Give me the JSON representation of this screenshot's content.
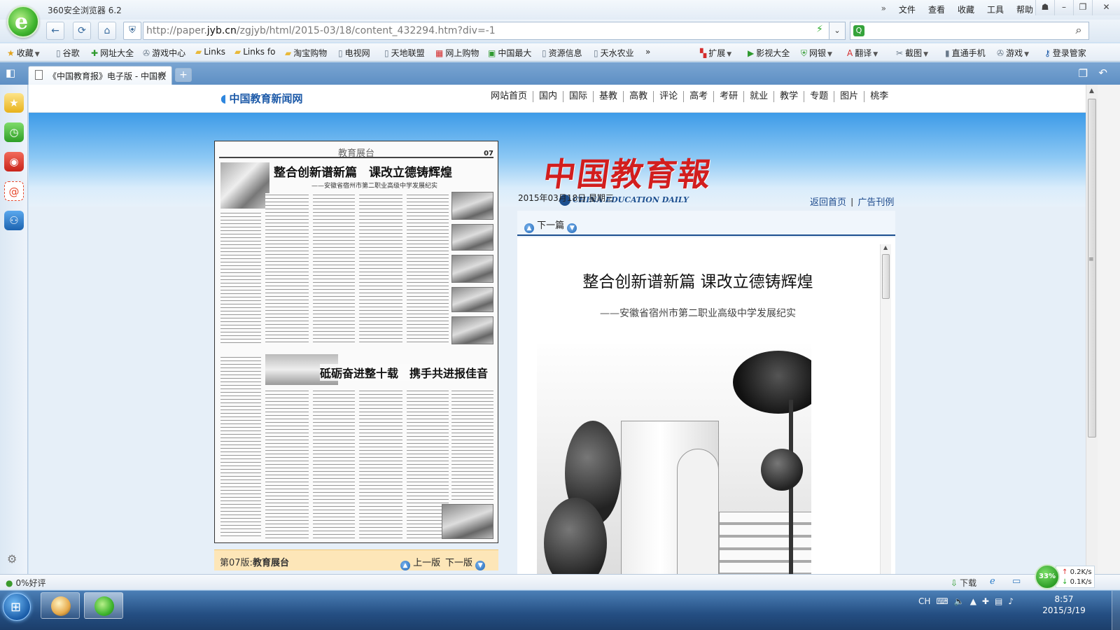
{
  "window": {
    "app_title": "360安全浏览器 6.2",
    "menu": [
      "文件",
      "查看",
      "收藏",
      "工具",
      "帮助"
    ],
    "menu_chevron": "»"
  },
  "navbar": {
    "url_prefix": "http://paper.",
    "url_domain": "jyb.cn",
    "url_suffix": "/zgjyb/html/2015-03/18/content_432294.htm?div=-1",
    "search_placeholder": ""
  },
  "bookmarks": {
    "left": [
      {
        "label": "收藏",
        "icon": "star-icon"
      },
      {
        "label": "谷歌",
        "icon": "page-icon"
      },
      {
        "label": "网址大全",
        "icon": "green-plus-icon"
      },
      {
        "label": "游戏中心",
        "icon": "gamepad-icon"
      },
      {
        "label": "Links",
        "icon": "folder-icon"
      },
      {
        "label": "Links fo",
        "icon": "folder-icon"
      },
      {
        "label": "淘宝购物",
        "icon": "folder-icon"
      },
      {
        "label": "电视网",
        "icon": "page-icon"
      },
      {
        "label": "天地联盟",
        "icon": "page-icon"
      },
      {
        "label": "网上购物",
        "icon": "red-grid-icon"
      },
      {
        "label": "中国最大",
        "icon": "green-badge-icon"
      },
      {
        "label": "资源信息",
        "icon": "page-icon"
      },
      {
        "label": "天水农业",
        "icon": "page-icon"
      }
    ],
    "more": "»",
    "right": [
      {
        "label": "扩展",
        "icon": "puzzle-icon"
      },
      {
        "label": "影视大全",
        "icon": "video-icon"
      },
      {
        "label": "网银",
        "icon": "shield-icon"
      },
      {
        "label": "翻译",
        "icon": "translate-icon"
      },
      {
        "label": "截图",
        "icon": "screenshot-icon"
      },
      {
        "label": "直通手机",
        "icon": "phone-icon"
      },
      {
        "label": "游戏",
        "icon": "gamepad-icon"
      },
      {
        "label": "登录管家",
        "icon": "key-icon"
      }
    ]
  },
  "tabs": {
    "active_title": "《中国教育报》电子版 - 中国教",
    "close_glyph": "×",
    "new_glyph": "+"
  },
  "site": {
    "logo_text": "中国教育新闻网",
    "nav": [
      "网站首页",
      "国内",
      "国际",
      "基教",
      "高教",
      "评论",
      "高考",
      "考研",
      "就业",
      "教学",
      "专题",
      "图片",
      "桃李"
    ],
    "paper_logo": "中国教育報",
    "paper_sub": "CHINA EDUCATION DAILY",
    "header_links": [
      "返回首页",
      "广告刊例"
    ],
    "date": "2015年03月18日  星期三"
  },
  "thumbnail": {
    "section": "教育展台",
    "page_no": "07",
    "headline": "整合创新谱新篇　课改立德铸辉煌",
    "subheadline": "——安徽省宿州市第二职业高级中学发展纪实",
    "headline2": "砥砺奋进整十载　携手共进报佳音"
  },
  "page_bar": {
    "label_prefix": "第07版:",
    "label_name": "教育展台",
    "prev": "上一版",
    "next": "下一版"
  },
  "article": {
    "next_article": "下一篇",
    "title": "整合创新谱新篇  课改立德铸辉煌",
    "subtitle": "——安徽省宿州市第二职业高级中学发展纪实"
  },
  "statusbar": {
    "rating": "0%好评",
    "download": "下载",
    "speed_percent": "33%",
    "upload_speed": "0.2K/s",
    "download_speed": "0.1K/s"
  },
  "taskbar": {
    "tray_lang": "CH",
    "time": "8:57",
    "date": "2015/3/19"
  },
  "colors": {
    "paper_red": "#d21e1e",
    "site_blue": "#1d5aa8",
    "taskbar": "#244e82"
  }
}
